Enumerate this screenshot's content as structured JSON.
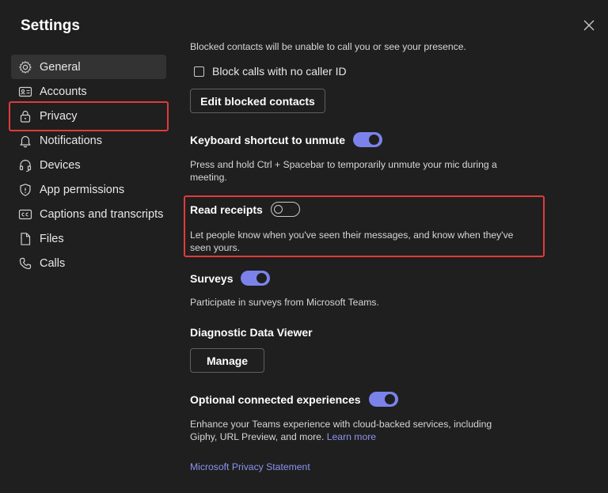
{
  "window": {
    "title": "Settings"
  },
  "sidebar": {
    "items": [
      {
        "label": "General",
        "icon": "gear-icon"
      },
      {
        "label": "Accounts",
        "icon": "id-card-icon"
      },
      {
        "label": "Privacy",
        "icon": "lock-icon"
      },
      {
        "label": "Notifications",
        "icon": "bell-icon"
      },
      {
        "label": "Devices",
        "icon": "headset-icon"
      },
      {
        "label": "App permissions",
        "icon": "shield-icon"
      },
      {
        "label": "Captions and transcripts",
        "icon": "cc-icon"
      },
      {
        "label": "Files",
        "icon": "file-icon"
      },
      {
        "label": "Calls",
        "icon": "phone-icon"
      }
    ],
    "selected": "General",
    "highlighted": "Privacy"
  },
  "privacy": {
    "blocked_desc": "Blocked contacts will be unable to call you or see your presence.",
    "block_no_caller_id": {
      "label": "Block calls with no caller ID",
      "checked": false
    },
    "edit_blocked_label": "Edit blocked contacts",
    "shortcut": {
      "heading": "Keyboard shortcut to unmute",
      "enabled": true,
      "desc_line1": "Press and hold Ctrl + Spacebar to temporarily unmute your mic during a",
      "desc_line2": "meeting."
    },
    "read_receipts": {
      "heading": "Read receipts",
      "enabled": false,
      "desc_line1": "Let people know when you've seen their messages, and know when they've",
      "desc_line2": "seen yours."
    },
    "surveys": {
      "heading": "Surveys",
      "enabled": true,
      "desc": "Participate in surveys from Microsoft Teams."
    },
    "diagnostic": {
      "heading": "Diagnostic Data Viewer",
      "manage_label": "Manage"
    },
    "optional": {
      "heading": "Optional connected experiences",
      "enabled": true,
      "desc_line1": "Enhance your Teams experience with cloud-backed services, including",
      "desc_line2": "Giphy, URL Preview, and more.",
      "learn_more": "Learn more"
    },
    "privacy_statement": "Microsoft Privacy Statement"
  },
  "colors": {
    "accent": "#7b83eb",
    "highlight": "#e23a3a",
    "background": "#1f1f1f",
    "link": "#8d93f0"
  }
}
